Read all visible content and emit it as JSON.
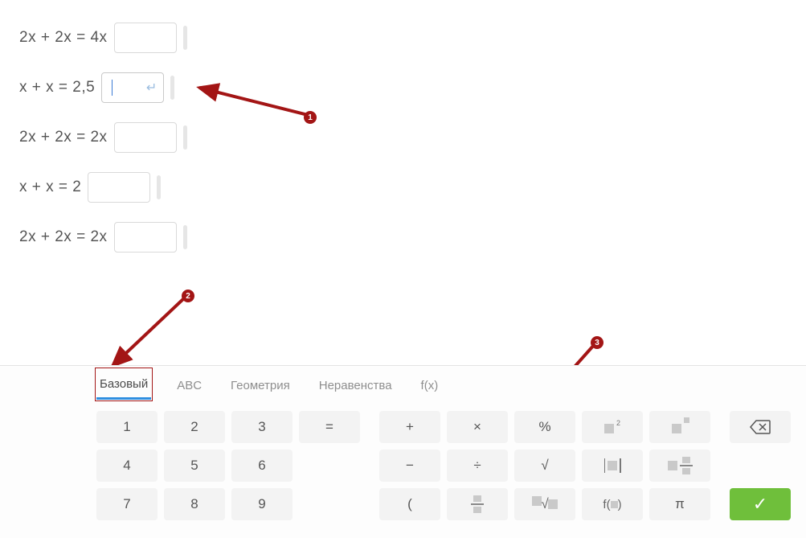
{
  "equations": [
    {
      "text": "2x + 2x = 4x",
      "active": false
    },
    {
      "text": "x + x = 2,5",
      "active": true
    },
    {
      "text": "2x + 2x = 2x",
      "active": false
    },
    {
      "text": "x + x = 2",
      "active": false
    },
    {
      "text": "2x + 2x = 2x",
      "active": false
    }
  ],
  "annotations": {
    "b1": "1",
    "b2": "2",
    "b3": "3"
  },
  "tabs": {
    "basic": "Базовый",
    "abc": "ABC",
    "geom": "Геометрия",
    "ineq": "Неравенства",
    "fx": "f(x)"
  },
  "keys": {
    "n1": "1",
    "n2": "2",
    "n3": "3",
    "n4": "4",
    "n5": "5",
    "n6": "6",
    "n7": "7",
    "n8": "8",
    "n9": "9",
    "eq": "=",
    "plus": "+",
    "minus": "−",
    "times": "×",
    "div": "÷",
    "lparen": "(",
    "pct": "%",
    "sqrt": "√",
    "root": "√",
    "pi": "π",
    "fx": "f(   )",
    "sup2": "2"
  }
}
